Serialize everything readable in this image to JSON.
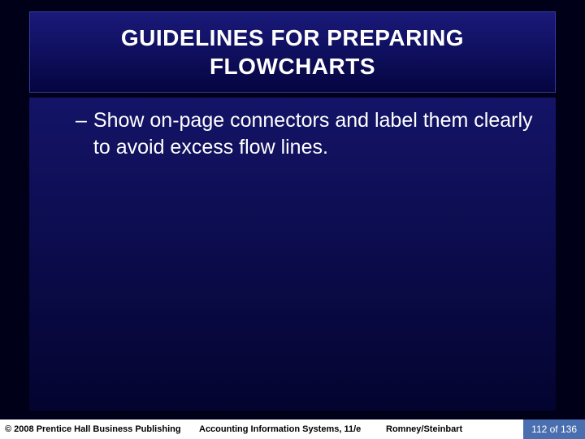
{
  "title": "GUIDELINES FOR PREPARING FLOWCHARTS",
  "bullet": {
    "dash": "–",
    "text": "Show on-page connectors and label them clearly to avoid excess flow lines."
  },
  "footer": {
    "copyright": "© 2008 Prentice Hall Business Publishing",
    "book": "Accounting Information Systems, 11/e",
    "authors": "Romney/Steinbart",
    "page": "112 of 136"
  }
}
